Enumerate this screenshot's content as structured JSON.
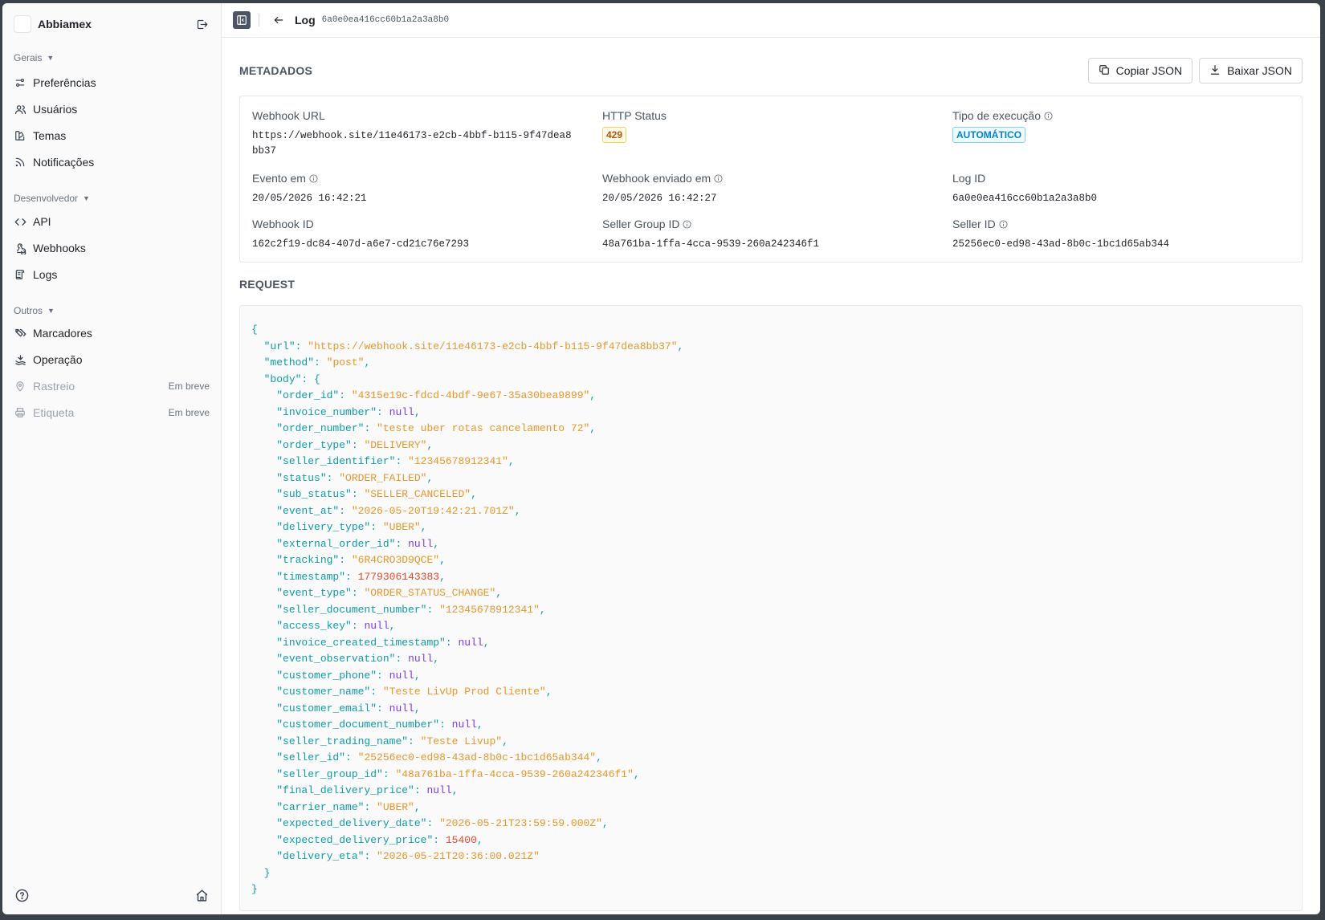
{
  "app": {
    "brand": "Abbiamex"
  },
  "sidebar": {
    "sections": [
      {
        "title": "Gerais",
        "items": [
          {
            "label": "Preferências",
            "icon": "sliders-icon"
          },
          {
            "label": "Usuários",
            "icon": "users-icon"
          },
          {
            "label": "Temas",
            "icon": "swatch-icon"
          },
          {
            "label": "Notificações",
            "icon": "rss-icon"
          }
        ]
      },
      {
        "title": "Desenvolvedor",
        "items": [
          {
            "label": "API",
            "icon": "code-icon"
          },
          {
            "label": "Webhooks",
            "icon": "webhook-icon"
          },
          {
            "label": "Logs",
            "icon": "scroll-icon"
          }
        ]
      },
      {
        "title": "Outros",
        "items": [
          {
            "label": "Marcadores",
            "icon": "tags-icon"
          },
          {
            "label": "Operação",
            "icon": "truck-icon"
          },
          {
            "label": "Rastreio",
            "icon": "map-pin-icon",
            "badge": "Em breve"
          },
          {
            "label": "Etiqueta",
            "icon": "printer-icon",
            "badge": "Em breve"
          }
        ]
      }
    ]
  },
  "topbar": {
    "title": "Log",
    "log_id": "6a0e0ea416cc60b1a2a3a8b0"
  },
  "metadata": {
    "section_title": "METADADOS",
    "copy_label": "Copiar JSON",
    "download_label": "Baixar JSON",
    "fields": {
      "webhook_url": {
        "label": "Webhook URL",
        "value": "https://webhook.site/11e46173-e2cb-4bbf-b115-9f47dea8bb37"
      },
      "http_status": {
        "label": "HTTP Status",
        "value": "429"
      },
      "exec_type": {
        "label": "Tipo de execução",
        "value": "AUTOMÁTICO"
      },
      "event_at": {
        "label": "Evento em",
        "value": "20/05/2026 16:42:21"
      },
      "sent_at": {
        "label": "Webhook enviado em",
        "value": "20/05/2026 16:42:27"
      },
      "log_id": {
        "label": "Log ID",
        "value": "6a0e0ea416cc60b1a2a3a8b0"
      },
      "webhook_id": {
        "label": "Webhook ID",
        "value": "162c2f19-dc84-407d-a6e7-cd21c76e7293"
      },
      "seller_group_id": {
        "label": "Seller Group ID",
        "value": "48a761ba-1ffa-4cca-9539-260a242346f1"
      },
      "seller_id": {
        "label": "Seller ID",
        "value": "25256ec0-ed98-43ad-8b0c-1bc1d65ab344"
      }
    }
  },
  "request": {
    "section_title": "REQUEST",
    "url": "https://webhook.site/11e46173-e2cb-4bbf-b115-9f47dea8bb37",
    "method": "post",
    "body": [
      {
        "key": "order_id",
        "value": "4315e19c-fdcd-4bdf-9e67-35a30bea9899",
        "type": "string"
      },
      {
        "key": "invoice_number",
        "value": "null",
        "type": "null"
      },
      {
        "key": "order_number",
        "value": "teste uber rotas cancelamento 72",
        "type": "string"
      },
      {
        "key": "order_type",
        "value": "DELIVERY",
        "type": "string"
      },
      {
        "key": "seller_identifier",
        "value": "12345678912341",
        "type": "string"
      },
      {
        "key": "status",
        "value": "ORDER_FAILED",
        "type": "string"
      },
      {
        "key": "sub_status",
        "value": "SELLER_CANCELED",
        "type": "string"
      },
      {
        "key": "event_at",
        "value": "2026-05-20T19:42:21.701Z",
        "type": "string"
      },
      {
        "key": "delivery_type",
        "value": "UBER",
        "type": "string"
      },
      {
        "key": "external_order_id",
        "value": "null",
        "type": "null"
      },
      {
        "key": "tracking",
        "value": "6R4CRO3D9QCE",
        "type": "string"
      },
      {
        "key": "timestamp",
        "value": "1779306143383",
        "type": "number"
      },
      {
        "key": "event_type",
        "value": "ORDER_STATUS_CHANGE",
        "type": "string"
      },
      {
        "key": "seller_document_number",
        "value": "12345678912341",
        "type": "string"
      },
      {
        "key": "access_key",
        "value": "null",
        "type": "null"
      },
      {
        "key": "invoice_created_timestamp",
        "value": "null",
        "type": "null"
      },
      {
        "key": "event_observation",
        "value": "null",
        "type": "null"
      },
      {
        "key": "customer_phone",
        "value": "null",
        "type": "null"
      },
      {
        "key": "customer_name",
        "value": "Teste LivUp Prod Cliente",
        "type": "string"
      },
      {
        "key": "customer_email",
        "value": "null",
        "type": "null"
      },
      {
        "key": "customer_document_number",
        "value": "null",
        "type": "null"
      },
      {
        "key": "seller_trading_name",
        "value": "Teste Livup",
        "type": "string"
      },
      {
        "key": "seller_id",
        "value": "25256ec0-ed98-43ad-8b0c-1bc1d65ab344",
        "type": "string"
      },
      {
        "key": "seller_group_id",
        "value": "48a761ba-1ffa-4cca-9539-260a242346f1",
        "type": "string"
      },
      {
        "key": "final_delivery_price",
        "value": "null",
        "type": "null"
      },
      {
        "key": "carrier_name",
        "value": "UBER",
        "type": "string"
      },
      {
        "key": "expected_delivery_date",
        "value": "2026-05-21T23:59:59.000Z",
        "type": "string"
      },
      {
        "key": "expected_delivery_price",
        "value": "15400",
        "type": "number"
      },
      {
        "key": "delivery_eta",
        "value": "2026-05-21T20:36:00.021Z",
        "type": "string"
      }
    ]
  },
  "colors": {
    "key": "#0f9ba8",
    "string": "#e8962a",
    "number": "#e5482d",
    "null": "#7c3aed",
    "status_warn": "#b45309",
    "exec_info": "#0284c7"
  }
}
